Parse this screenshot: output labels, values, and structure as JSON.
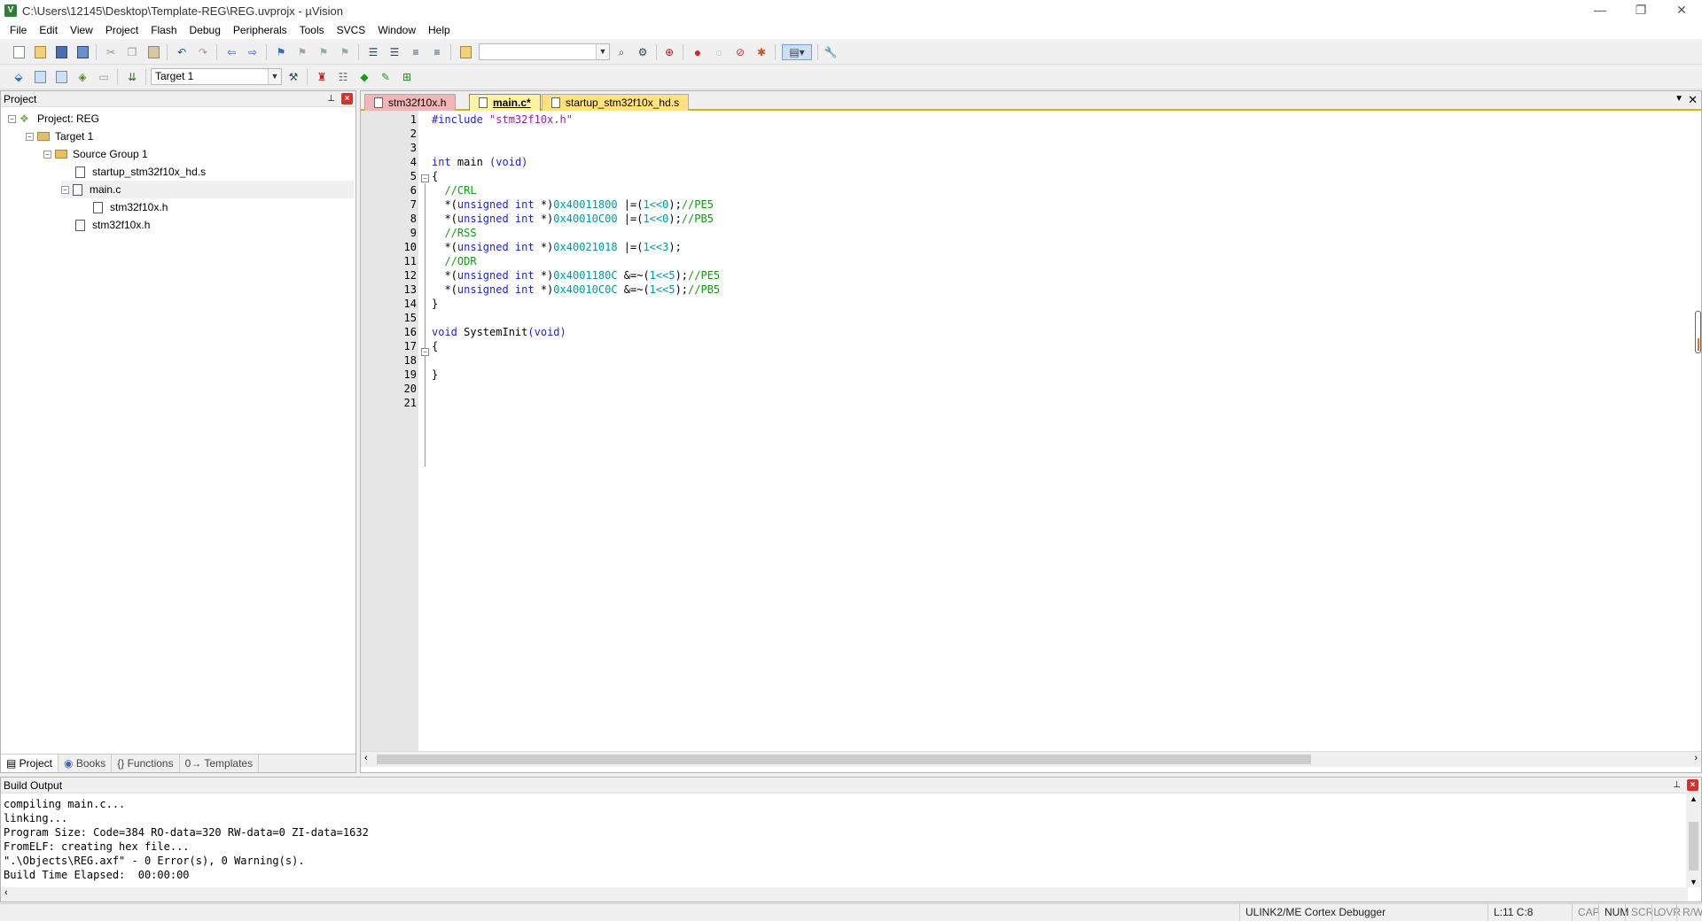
{
  "window": {
    "title": "C:\\Users\\12145\\Desktop\\Template-REG\\REG.uvprojx - µVision",
    "minimize": "—",
    "restore": "❐",
    "close": "✕"
  },
  "menu": [
    "File",
    "Edit",
    "View",
    "Project",
    "Flash",
    "Debug",
    "Peripherals",
    "Tools",
    "SVCS",
    "Window",
    "Help"
  ],
  "toolbar2": {
    "target_value": "Target 1"
  },
  "project_pane": {
    "title": "Project",
    "tree": {
      "project": "Project: REG",
      "target": "Target 1",
      "group": "Source Group 1",
      "startup": "startup_stm32f10x_hd.s",
      "main": "main.c",
      "main_dep": "stm32f10x.h",
      "header": "stm32f10x.h"
    },
    "tabs": [
      "Project",
      "Books",
      "{} Functions",
      "0→ Templates"
    ]
  },
  "editor": {
    "tabs": [
      {
        "label": "stm32f10x.h",
        "color": "#f2b6b6"
      },
      {
        "label": "main.c*",
        "color": "#fff3a0"
      },
      {
        "label": "startup_stm32f10x_hd.s",
        "color": "#ffe27a"
      }
    ],
    "line_numbers": [
      "1",
      "2",
      "3",
      "4",
      "5",
      "6",
      "7",
      "8",
      "9",
      "10",
      "11",
      "12",
      "13",
      "14",
      "15",
      "16",
      "17",
      "18",
      "19",
      "20",
      "21"
    ],
    "code": {
      "l1_directive": "#include",
      "l1_string": "\"stm32f10x.h\"",
      "l4_type": "int",
      "l4_name": " main ",
      "l4_params": "(void)",
      "l5": "{",
      "l6": "  //CRL",
      "l7_a": "  *(",
      "l7_b": "unsigned int",
      "l7_c": " *)",
      "l7_addr": "0x40011800",
      "l7_op": " |=(",
      "l7_val": "1<<0",
      "l7_end": ");",
      "l7_cmt": "//PE5",
      "l8_addr": "0x40010C00",
      "l8_cmt": "//PB5",
      "l9": "  //RSS",
      "l10_addr": "0x40021018",
      "l10_val": "1<<3",
      "l11": "  //ODR",
      "l12_addr": "0x4001180C",
      "l12_op": " &=~(",
      "l12_val": "1<<5",
      "l12_cmt": "//PE5",
      "l13_addr": "0x40010C0C",
      "l13_cmt": "//PB5",
      "l14": "}",
      "l16_type": "void",
      "l16_name": " SystemInit",
      "l16_params": "(void)",
      "l17": "{",
      "l19": "}"
    }
  },
  "build_output": {
    "title": "Build Output",
    "lines": [
      "compiling main.c...",
      "linking...",
      "Program Size: Code=384 RO-data=320 RW-data=0 ZI-data=1632",
      "FromELF: creating hex file...",
      "\".\\Objects\\REG.axf\" - 0 Error(s), 0 Warning(s).",
      "Build Time Elapsed:  00:00:00"
    ]
  },
  "status": {
    "debugger": "ULINK2/ME Cortex Debugger",
    "position": "L:11 C:8",
    "cap": "CAP",
    "num": "NUM",
    "scrl": "SCRL",
    "ovr": "OVR",
    "rw": "R/W"
  },
  "colors": {
    "keyword": "#1f1fd6",
    "string": "#9a1aa8",
    "number": "#009a9a",
    "comment": "#129812"
  }
}
